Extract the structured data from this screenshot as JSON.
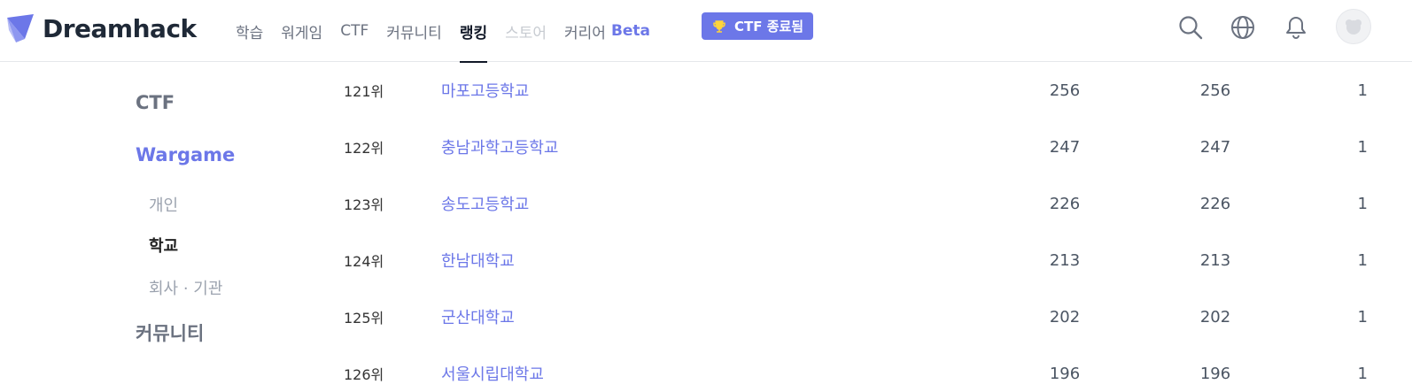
{
  "header": {
    "logo_text": "Dreamhack",
    "nav": [
      {
        "label": "학습",
        "state": "normal"
      },
      {
        "label": "워게임",
        "state": "normal"
      },
      {
        "label": "CTF",
        "state": "normal"
      },
      {
        "label": "커뮤니티",
        "state": "normal"
      },
      {
        "label": "랭킹",
        "state": "active"
      },
      {
        "label": "스토어",
        "state": "disabled"
      },
      {
        "label": "커리어",
        "state": "normal"
      }
    ],
    "beta_label": "Beta",
    "ctf_badge_label": "CTF 종료됨",
    "icons": [
      "search-icon",
      "globe-icon",
      "bell-icon",
      "avatar"
    ]
  },
  "sidebar": {
    "categories": [
      "CTF",
      "Wargame",
      "커뮤니티"
    ],
    "wargame_sub": [
      "개인",
      "학교",
      "회사 · 기관"
    ],
    "active_category": "Wargame",
    "active_sub": "학교"
  },
  "ranking": {
    "rows": [
      {
        "rank": "121위",
        "name": "마포고등학교",
        "score": "256",
        "score2": "256",
        "members": "1"
      },
      {
        "rank": "122위",
        "name": "충남과학고등학교",
        "score": "247",
        "score2": "247",
        "members": "1"
      },
      {
        "rank": "123위",
        "name": "송도고등학교",
        "score": "226",
        "score2": "226",
        "members": "1"
      },
      {
        "rank": "124위",
        "name": "한남대학교",
        "score": "213",
        "score2": "213",
        "members": "1"
      },
      {
        "rank": "125위",
        "name": "군산대학교",
        "score": "202",
        "score2": "202",
        "members": "1"
      },
      {
        "rank": "126위",
        "name": "서울시립대학교",
        "score": "196",
        "score2": "196",
        "members": "1"
      }
    ]
  },
  "colors": {
    "accent": "#6c77e8",
    "text_dark": "#111827",
    "text_muted": "#6b7280",
    "border": "#e5e7eb"
  }
}
